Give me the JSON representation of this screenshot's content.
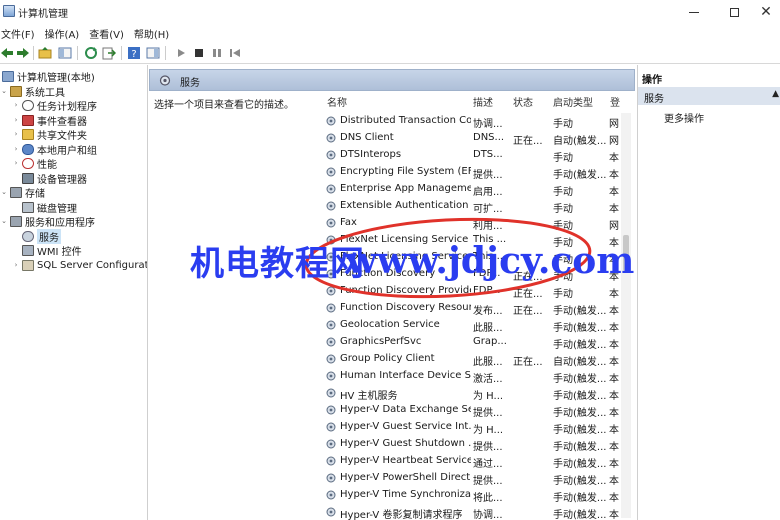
{
  "window": {
    "title": "计算机管理",
    "minimize_glyph": "—",
    "close_glyph": "✕"
  },
  "menu": [
    "文件(F)",
    "操作(A)",
    "查看(V)",
    "帮助(H)"
  ],
  "toolbar_icons": [
    "back-arrow-icon",
    "forward-arrow-icon",
    "up-folder-icon",
    "console-tree-icon",
    "refresh-icon",
    "export-icon",
    "help-icon",
    "show-hide-icon",
    "play-icon",
    "stop-icon",
    "pause-icon",
    "restart-icon"
  ],
  "tree": [
    {
      "label": "计算机管理(本地)",
      "icon": "computer-management-icon",
      "expander": ""
    },
    {
      "label": "系统工具",
      "icon": "system-tools-icon",
      "expander": "⌄"
    },
    {
      "label": "任务计划程序",
      "icon": "task-scheduler-icon",
      "expander": "›"
    },
    {
      "label": "事件查看器",
      "icon": "event-viewer-icon",
      "expander": "›"
    },
    {
      "label": "共享文件夹",
      "icon": "shared-folders-icon",
      "expander": "›"
    },
    {
      "label": "本地用户和组",
      "icon": "users-icon",
      "expander": "›"
    },
    {
      "label": "性能",
      "icon": "performance-icon",
      "expander": "›"
    },
    {
      "label": "设备管理器",
      "icon": "device-manager-icon",
      "expander": ""
    },
    {
      "label": "存储",
      "icon": "storage-icon",
      "expander": "⌄"
    },
    {
      "label": "磁盘管理",
      "icon": "disk-management-icon",
      "expander": ""
    },
    {
      "label": "服务和应用程序",
      "icon": "services-apps-icon",
      "expander": "⌄"
    },
    {
      "label": "服务",
      "icon": "services-icon",
      "expander": ""
    },
    {
      "label": "WMI 控件",
      "icon": "wmi-icon",
      "expander": ""
    },
    {
      "label": "SQL Server Configurati",
      "icon": "sql-server-icon",
      "expander": "›"
    }
  ],
  "middle": {
    "header_title": "服务",
    "description_prompt": "选择一个项目来查看它的描述。",
    "columns": {
      "name": "名称",
      "desc": "描述",
      "status": "状态",
      "startup": "启动类型",
      "logon": "登"
    },
    "services": [
      {
        "name": "Distributed Transaction Co...",
        "desc": "协调...",
        "status": "",
        "startup": "手动",
        "logon": "网"
      },
      {
        "name": "DNS Client",
        "desc": "DNS...",
        "status": "正在...",
        "startup": "自动(触发...",
        "logon": "网"
      },
      {
        "name": "DTSInterops",
        "desc": "DTS...",
        "status": "",
        "startup": "手动",
        "logon": "本"
      },
      {
        "name": "Encrypting File System (EFS)",
        "desc": "提供...",
        "status": "",
        "startup": "手动(触发...",
        "logon": "本"
      },
      {
        "name": "Enterprise App Manageme...",
        "desc": "启用...",
        "status": "",
        "startup": "手动",
        "logon": "本"
      },
      {
        "name": "Extensible Authentication ...",
        "desc": "可扩...",
        "status": "",
        "startup": "手动",
        "logon": "本"
      },
      {
        "name": "Fax",
        "desc": "利用...",
        "status": "",
        "startup": "手动",
        "logon": "网"
      },
      {
        "name": "FlexNet Licensing Service",
        "desc": "This ...",
        "status": "",
        "startup": "手动",
        "logon": "本"
      },
      {
        "name": "FlexNet Licensing Service",
        "desc": "This ...",
        "status": "",
        "startup": "手动",
        "logon": "本"
      },
      {
        "name": "Function Discovery",
        "desc": "FDP...",
        "status": "正在...",
        "startup": "手动",
        "logon": "本"
      },
      {
        "name": "Function Discovery Provide...",
        "desc": "FDP...",
        "status": "正在...",
        "startup": "手动",
        "logon": "本"
      },
      {
        "name": "Function Discovery Resour...",
        "desc": "发布...",
        "status": "正在...",
        "startup": "手动(触发...",
        "logon": "本"
      },
      {
        "name": "Geolocation Service",
        "desc": "此服...",
        "status": "",
        "startup": "手动(触发...",
        "logon": "本"
      },
      {
        "name": "GraphicsPerfSvc",
        "desc": "Grap...",
        "status": "",
        "startup": "手动(触发...",
        "logon": "本"
      },
      {
        "name": "Group Policy Client",
        "desc": "此服...",
        "status": "正在...",
        "startup": "自动(触发...",
        "logon": "本"
      },
      {
        "name": "Human Interface Device S...",
        "desc": "激活...",
        "status": "",
        "startup": "手动(触发...",
        "logon": "本"
      },
      {
        "name": "HV 主机服务",
        "desc": "为 H...",
        "status": "",
        "startup": "手动(触发...",
        "logon": "本"
      },
      {
        "name": "Hyper-V Data Exchange Se...",
        "desc": "提供...",
        "status": "",
        "startup": "手动(触发...",
        "logon": "本"
      },
      {
        "name": "Hyper-V Guest Service Int...",
        "desc": "为 H...",
        "status": "",
        "startup": "手动(触发...",
        "logon": "本"
      },
      {
        "name": "Hyper-V Guest Shutdown ...",
        "desc": "提供...",
        "status": "",
        "startup": "手动(触发...",
        "logon": "本"
      },
      {
        "name": "Hyper-V Heartbeat Service",
        "desc": "通过...",
        "status": "",
        "startup": "手动(触发...",
        "logon": "本"
      },
      {
        "name": "Hyper-V PowerShell Direct...",
        "desc": "提供...",
        "status": "",
        "startup": "手动(触发...",
        "logon": "本"
      },
      {
        "name": "Hyper-V Time Synchroniza...",
        "desc": "将此...",
        "status": "",
        "startup": "手动(触发...",
        "logon": "本"
      },
      {
        "name": "Hyper-V 卷影复制请求程序",
        "desc": "协调...",
        "status": "",
        "startup": "手动(触发...",
        "logon": "本"
      }
    ]
  },
  "actions": {
    "title": "操作",
    "section": "服务",
    "collapse_glyph": "▲",
    "more": "更多操作"
  },
  "watermark": {
    "text_cn": "机电教程网",
    "text_url": "www.jdjcy.com"
  },
  "colors": {
    "selection": "#cce4f7",
    "header_band": "#aebfd8",
    "watermark": "#2a3df0",
    "circle": "#e0322a"
  }
}
